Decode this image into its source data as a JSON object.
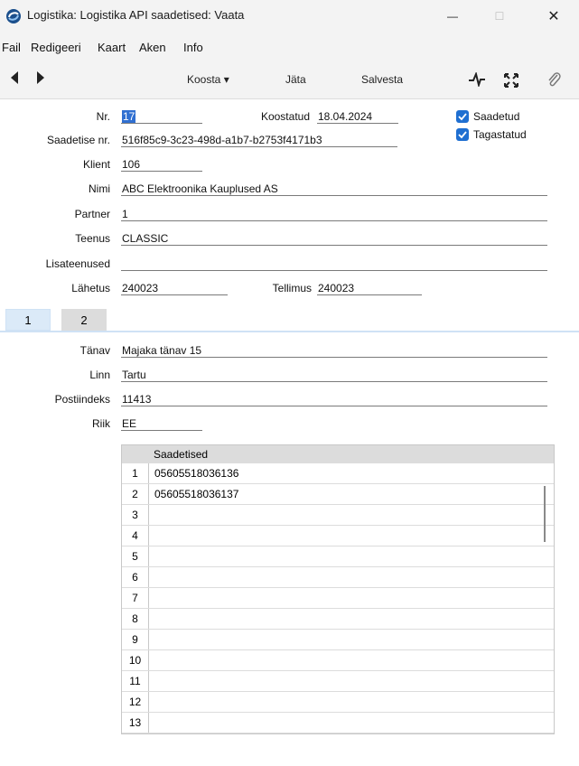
{
  "window": {
    "title": "Logistika: Logistika API saadetised: Vaata",
    "minimize_glyph": "—",
    "maximize_glyph": "☐",
    "close_glyph": "✕",
    "icon": "app-logo-icon"
  },
  "menu": {
    "items": [
      "Fail",
      "Redigeeri",
      "Kaart",
      "Aken",
      "Info"
    ]
  },
  "toolbar": {
    "back_icon": "back-arrow-icon",
    "forward_icon": "forward-arrow-icon",
    "koosta_label": "Koosta ▾",
    "jata_label": "Jäta",
    "salvesta_label": "Salvesta",
    "icons": [
      "activity-icon",
      "expand-icon",
      "paperclip-icon"
    ]
  },
  "form": {
    "nr_label": "Nr.",
    "nr_value": "17",
    "koostatud_label": "Koostatud",
    "koostatud_value": "18.04.2024",
    "saadetud_label": "Saadetud",
    "saadetud_checked": true,
    "tagastatud_label": "Tagastatud",
    "tagastatud_checked": true,
    "saadetise_nr_label": "Saadetise nr.",
    "saadetise_nr_value": "516f85c9-3c23-498d-a1b7-b2753f4171b3",
    "klient_label": "Klient",
    "klient_value": "106",
    "nimi_label": "Nimi",
    "nimi_value": "ABC Elektroonika Kauplused AS",
    "partner_label": "Partner",
    "partner_value": "1",
    "teenus_label": "Teenus",
    "teenus_value": "CLASSIC",
    "lisateenused_label": "Lisateenused",
    "lisateenused_value": "",
    "lahetus_label": "Lähetus",
    "lahetus_value": "240023",
    "tellimus_label": "Tellimus",
    "tellimus_value": "240023"
  },
  "tabs": [
    {
      "label": "1",
      "active": true
    },
    {
      "label": "2",
      "active": false
    }
  ],
  "address": {
    "tanav_label": "Tänav",
    "tanav_value": "Majaka tänav 15",
    "linn_label": "Linn",
    "linn_value": "Tartu",
    "postiindeks_label": "Postiindeks",
    "postiindeks_value": "11413",
    "riik_label": "Riik",
    "riik_value": "EE"
  },
  "grid": {
    "column_header": "Saadetised",
    "rows": [
      {
        "n": "1",
        "value": "05605518036136"
      },
      {
        "n": "2",
        "value": "05605518036137"
      },
      {
        "n": "3",
        "value": ""
      },
      {
        "n": "4",
        "value": ""
      },
      {
        "n": "5",
        "value": ""
      },
      {
        "n": "6",
        "value": ""
      },
      {
        "n": "7",
        "value": ""
      },
      {
        "n": "8",
        "value": ""
      },
      {
        "n": "9",
        "value": ""
      },
      {
        "n": "10",
        "value": ""
      },
      {
        "n": "11",
        "value": ""
      },
      {
        "n": "12",
        "value": ""
      },
      {
        "n": "13",
        "value": ""
      }
    ]
  },
  "colors": {
    "accent": "#1f6fd1",
    "chrome": "#f3f3f3",
    "tab_active": "#dbeaf8",
    "tab_inactive": "#dcdcdc"
  }
}
